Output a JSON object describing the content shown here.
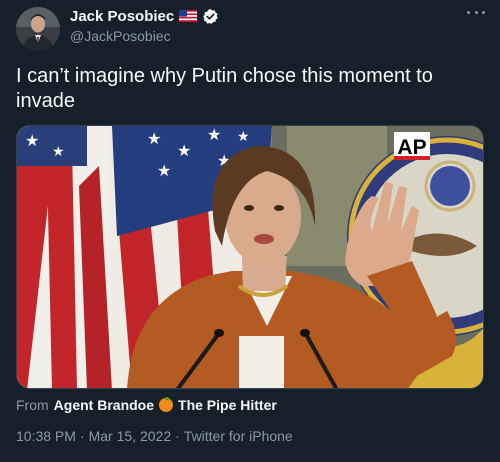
{
  "author": {
    "display_name": "Jack Posobiec",
    "handle": "@JackPosobiec",
    "flag_icon": "us-flag-icon",
    "verified_icon": "verified-badge-icon"
  },
  "tweet": {
    "text": "I can’t imagine why Putin chose this moment to invade"
  },
  "media": {
    "watermark": "AP"
  },
  "attribution": {
    "from_label": "From",
    "account_1": "Agent Brandoe",
    "account_2": "The Pipe Hitter",
    "emoji_icon": "orange-icon"
  },
  "meta": {
    "time": "10:38 PM",
    "separator_1": "·",
    "date": "Mar 15, 2022",
    "separator_2": "·",
    "client": "Twitter for iPhone"
  },
  "colors": {
    "background": "#15202b",
    "text_primary": "#f7f9f9",
    "text_secondary": "#8b98a5",
    "verified": "#ffffff"
  }
}
